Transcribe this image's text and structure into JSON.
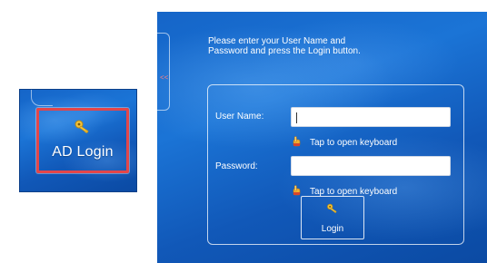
{
  "thumbnail": {
    "ad_login_label": "AD Login",
    "icon": "key-icon",
    "highlight_color": "#e3464a"
  },
  "side_tab": {
    "arrows_label": "<<"
  },
  "login_form": {
    "instructions": "Please enter your User Name and Password and press the Login button.",
    "username_label": "User Name:",
    "username_value": "",
    "password_label": "Password:",
    "password_value": "",
    "keyboard_hint": "Tap to open keyboard",
    "login_label": "Login",
    "icons": {
      "keyboard_hint": "pointing-hand-icon",
      "login": "key-icon"
    }
  },
  "colors": {
    "background": "#1565c8",
    "text": "#ffffff"
  }
}
